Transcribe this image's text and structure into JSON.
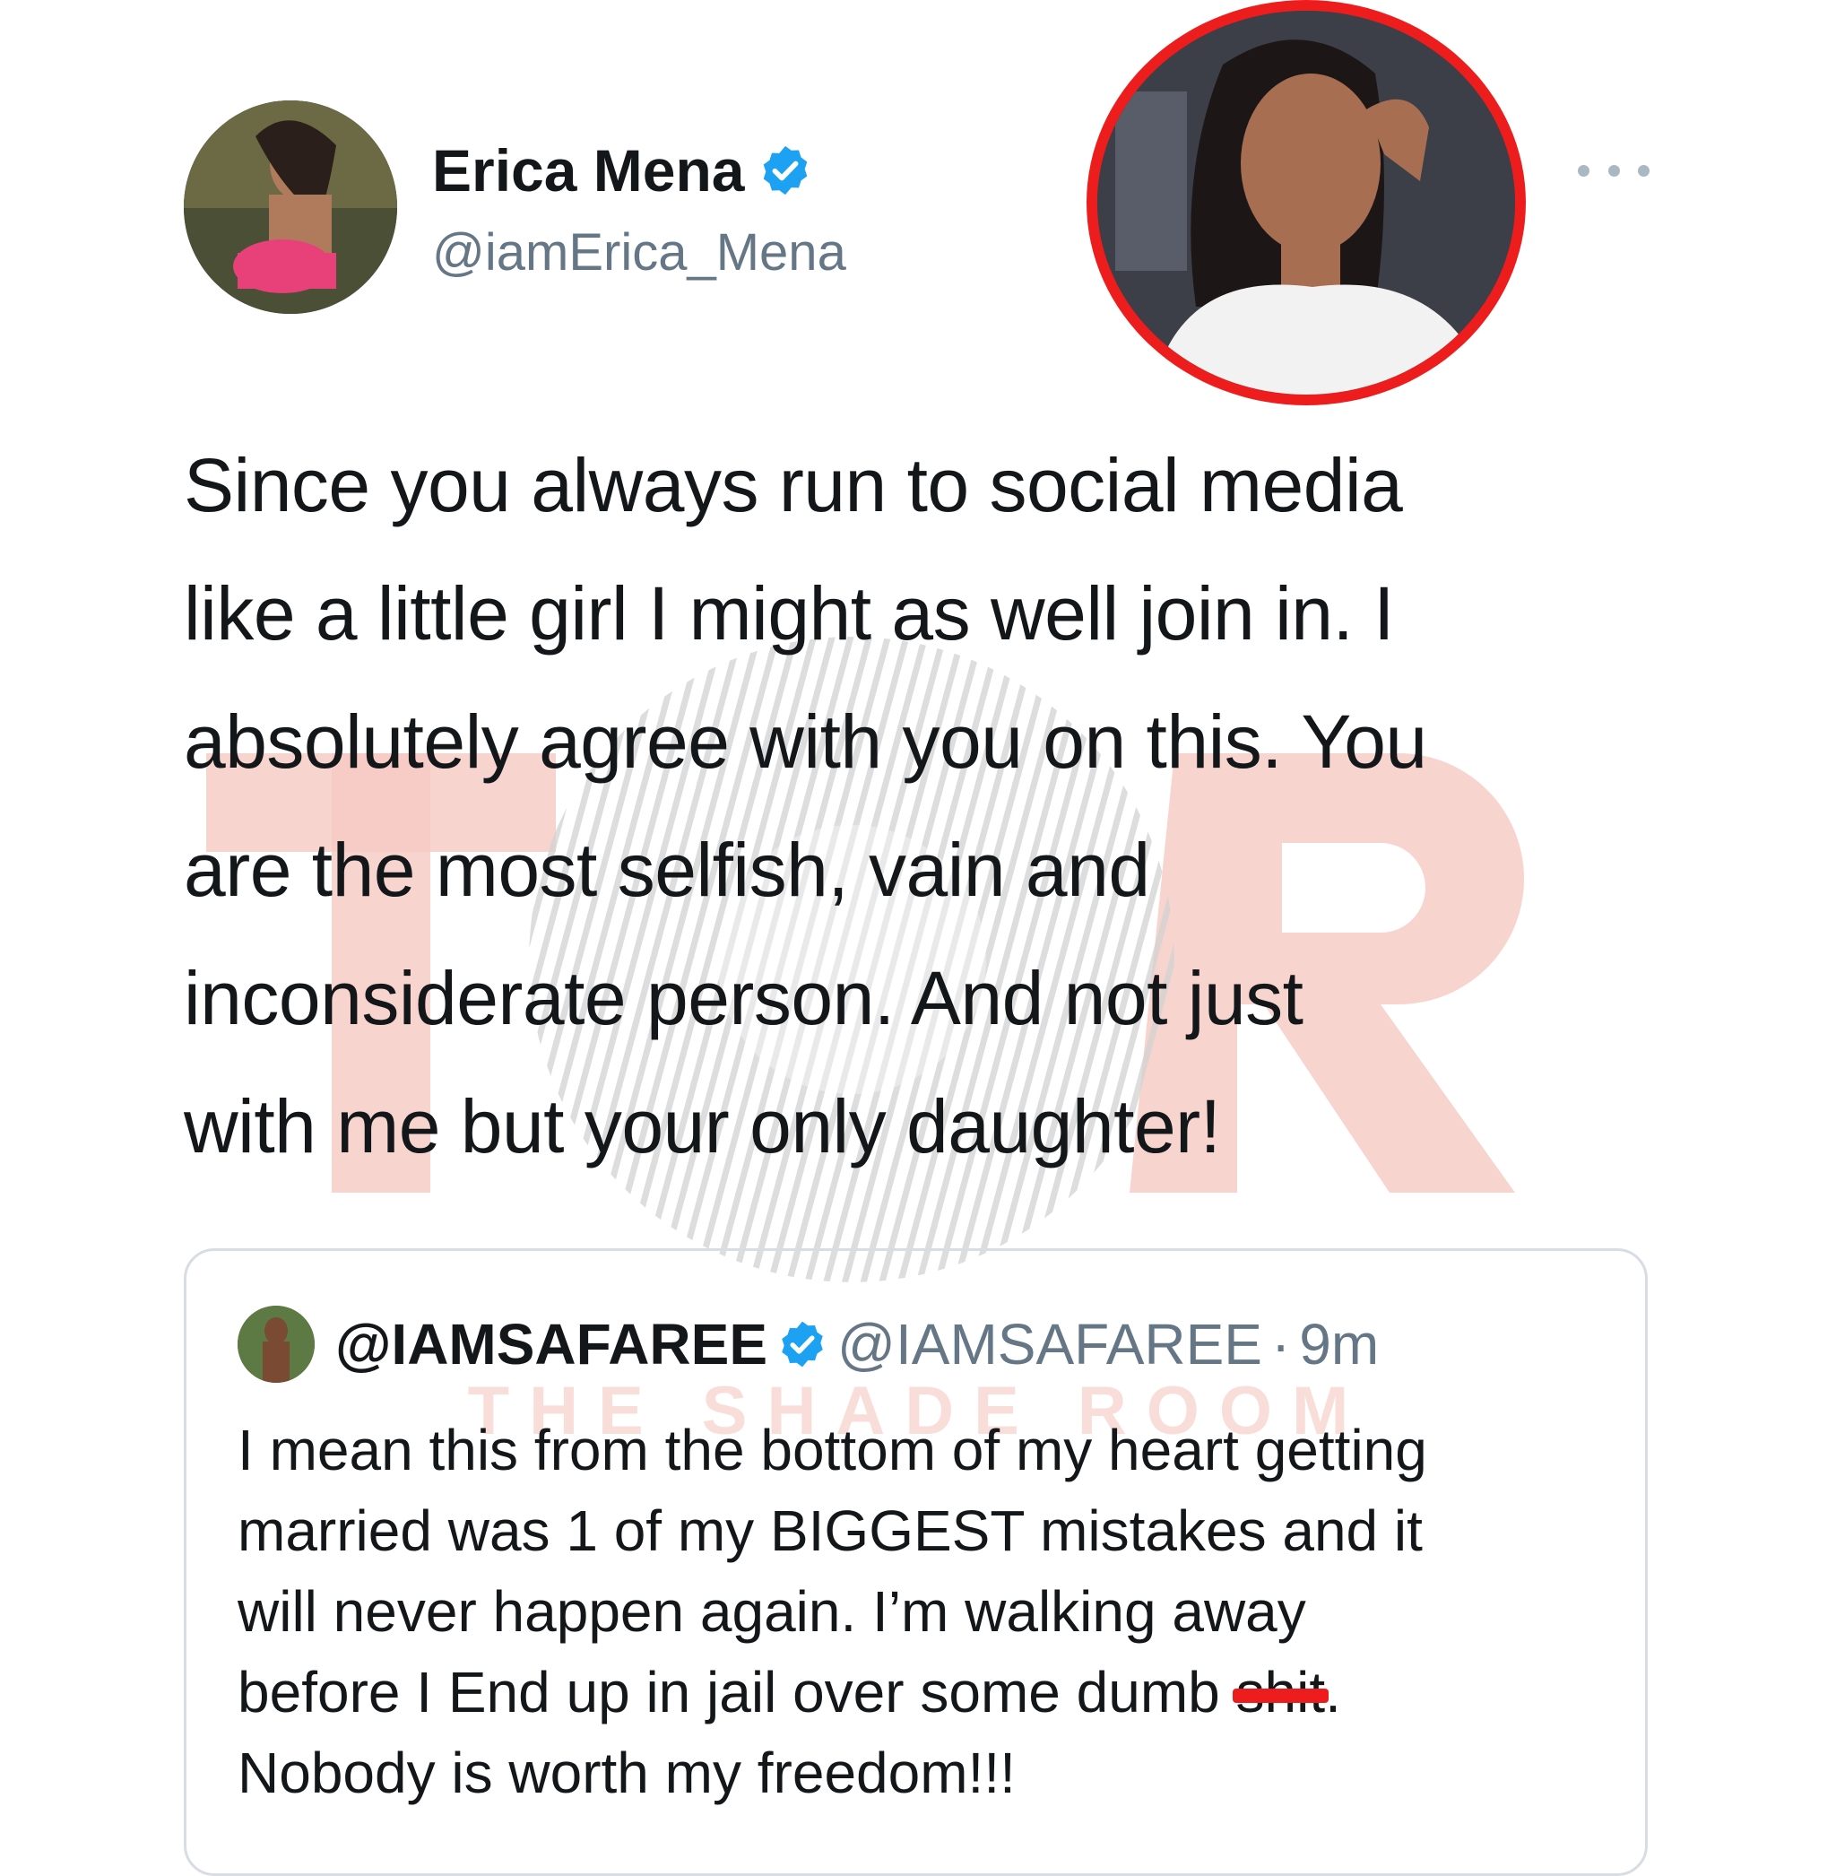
{
  "colors": {
    "verified_blue": "#1da1f2",
    "highlight_ring": "#ee1d1d",
    "watermark_pink": "#f6c9c3",
    "secondary_text": "#657786",
    "primary_text": "#14171a"
  },
  "tweet": {
    "author_name": "Erica Mena",
    "author_handle": "@iamErica_Mena",
    "verified_icon": "verified-badge-icon",
    "more_icon": "more-horizontal-icon",
    "lines": [
      "Since you always run to social media",
      "like a little girl I might as well join in. I",
      "absolutely agree with you on this. You",
      "are the most selfish, vain and",
      "inconsiderate person. And not just",
      "with me but your only daughter!"
    ]
  },
  "quoted_tweet": {
    "display_name": "@IAMSAFAREE",
    "handle": "@IAMSAFAREE",
    "separator": "·",
    "time": "9m",
    "verified_icon": "verified-badge-icon",
    "lines": [
      "I mean this from the bottom of my heart getting",
      "married was 1 of my BIGGEST mistakes and it",
      "will never happen again. I’m walking away"
    ],
    "line4_prefix": "before I End up in jail over some dumb ",
    "line4_redacted": "shit",
    "line4_suffix": ".",
    "line5": "Nobody is worth my freedom!!!"
  },
  "watermark": {
    "letters": "TSR",
    "text": "THE SHADE ROOM"
  }
}
